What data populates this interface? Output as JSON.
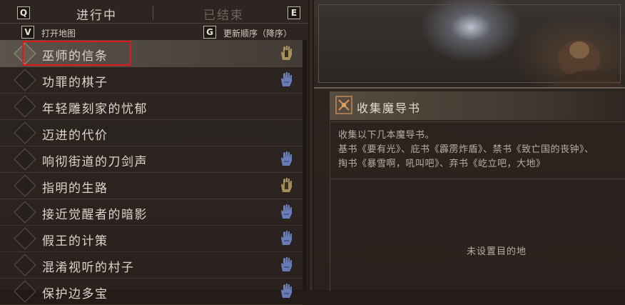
{
  "tabs": {
    "left_key": "Q",
    "right_key": "E",
    "active_label": "进行中",
    "inactive_label": "已结束"
  },
  "subbar": {
    "map_key": "V",
    "map_label": "打开地图",
    "sort_key": "G",
    "sort_label": "更新顺序（降序）"
  },
  "quests": [
    {
      "label": "巫师的信条",
      "icon": "hand-crest-icon",
      "selected": true
    },
    {
      "label": "功罪的棋子",
      "icon": "blue-hand-icon"
    },
    {
      "label": "年轻雕刻家的忧郁",
      "icon": ""
    },
    {
      "label": "迈进的代价",
      "icon": ""
    },
    {
      "label": "响彻街道的刀剑声",
      "icon": "blue-hand-icon"
    },
    {
      "label": "指明的生路",
      "icon": "hand-crest-icon"
    },
    {
      "label": "接近觉醒者的暗影",
      "icon": "blue-hand-icon"
    },
    {
      "label": "假王的计策",
      "icon": "blue-hand-icon"
    },
    {
      "label": "混淆视听的村子",
      "icon": "blue-hand-icon"
    },
    {
      "label": "保护边多宝",
      "icon": "blue-hand-icon"
    }
  ],
  "detail": {
    "title": "收集魔导书",
    "line1": "收集以下几本魔导书。",
    "line2": "基书《要有光》、庇书《霹雳炸盾》、禁书《致亡国的丧钟》、",
    "line3": "掏书《暴雪啊，吼叫吧》、弃书《屹立吧，大地》",
    "no_destination": "未设置目的地"
  },
  "colors": {
    "highlight": "#e0181a",
    "blue_hand": "#6f86c8",
    "gold_crest": "#b8a26a"
  }
}
